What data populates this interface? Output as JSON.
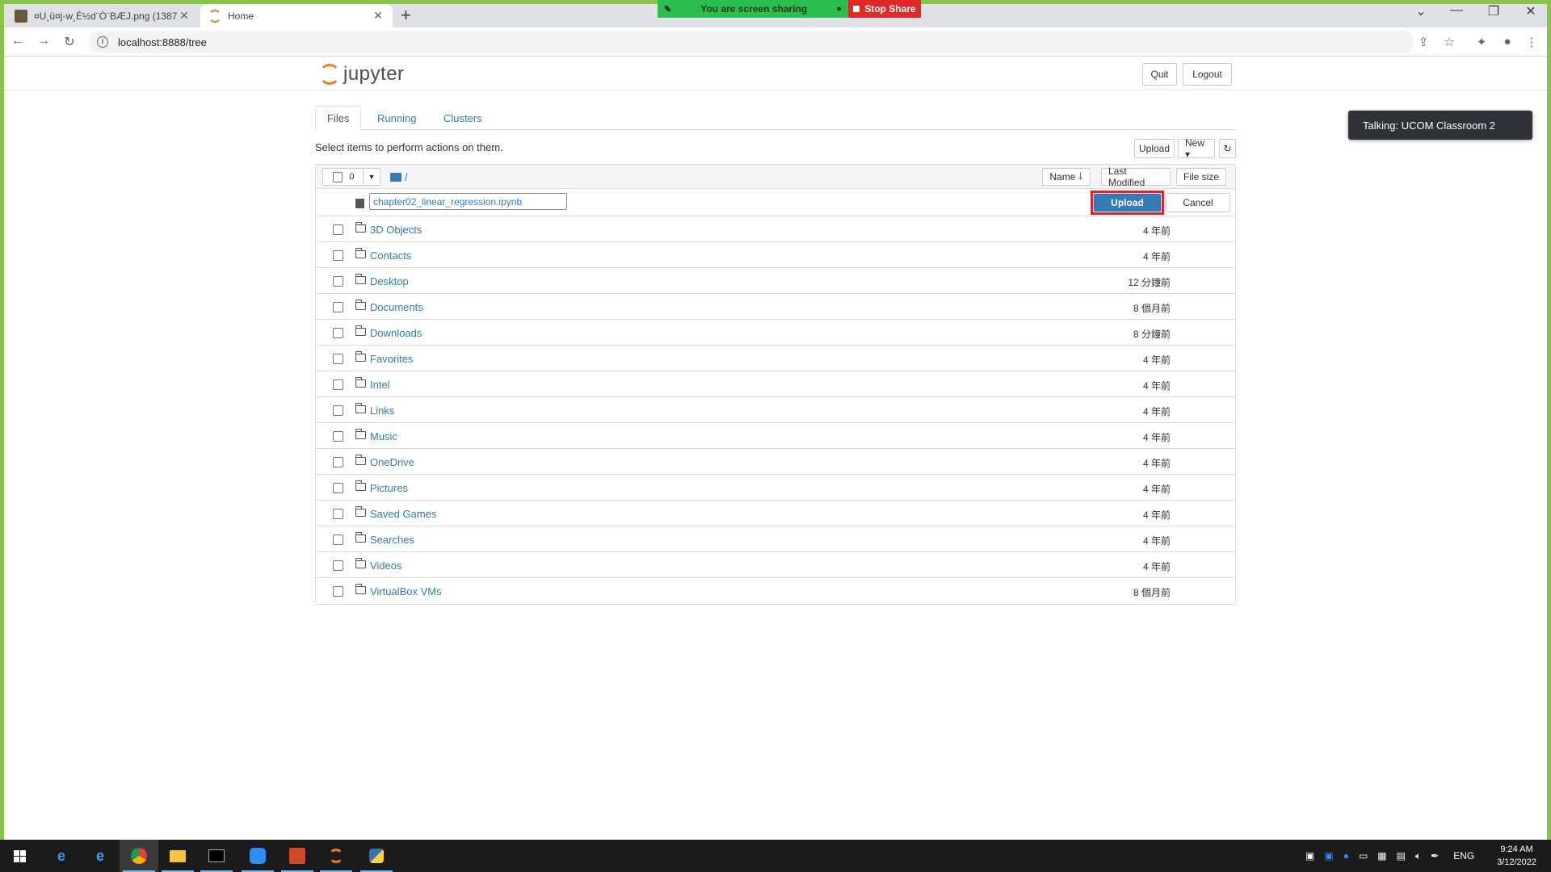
{
  "browser": {
    "tabs": [
      {
        "title": "¤U¸ü¤j·w¸É½d¨Ò¨BÆJ.png (1387×",
        "active": false
      },
      {
        "title": "Home",
        "active": true
      }
    ],
    "url": "localhost:8888/tree"
  },
  "screen_share": {
    "message": "You are screen sharing",
    "stop_label": "Stop Share"
  },
  "notification": "Talking: UCOM Classroom 2",
  "jupyter": {
    "logo_text": "jupyter",
    "quit_label": "Quit",
    "logout_label": "Logout",
    "tabs": [
      {
        "label": "Files",
        "active": true
      },
      {
        "label": "Running",
        "active": false
      },
      {
        "label": "Clusters",
        "active": false
      }
    ],
    "hint": "Select items to perform actions on them.",
    "upload_label": "Upload",
    "new_label": "New ▾",
    "selected_count": "0",
    "breadcrumb": "/",
    "columns": {
      "name": "Name",
      "last_modified": "Last Modified",
      "file_size": "File size"
    },
    "pending_upload": {
      "filename": "chapter02_linear_regression.ipynb",
      "upload_label": "Upload",
      "cancel_label": "Cancel"
    },
    "files": [
      {
        "name": "3D Objects",
        "modified": "4 年前"
      },
      {
        "name": "Contacts",
        "modified": "4 年前"
      },
      {
        "name": "Desktop",
        "modified": "12 分鐘前"
      },
      {
        "name": "Documents",
        "modified": "8 個月前"
      },
      {
        "name": "Downloads",
        "modified": "8 分鐘前"
      },
      {
        "name": "Favorites",
        "modified": "4 年前"
      },
      {
        "name": "Intel",
        "modified": "4 年前"
      },
      {
        "name": "Links",
        "modified": "4 年前"
      },
      {
        "name": "Music",
        "modified": "4 年前"
      },
      {
        "name": "OneDrive",
        "modified": "4 年前"
      },
      {
        "name": "Pictures",
        "modified": "4 年前"
      },
      {
        "name": "Saved Games",
        "modified": "4 年前"
      },
      {
        "name": "Searches",
        "modified": "4 年前"
      },
      {
        "name": "Videos",
        "modified": "4 年前"
      },
      {
        "name": "VirtualBox VMs",
        "modified": "8 個月前"
      }
    ]
  },
  "taskbar": {
    "language": "ENG",
    "time": "9:24 AM",
    "date": "3/12/2022"
  },
  "colors": {
    "share_frame": "#8bc34a",
    "link_blue": "#337ab7",
    "highlight_red": "#e0212b",
    "jupyter_orange": "#f37726"
  }
}
